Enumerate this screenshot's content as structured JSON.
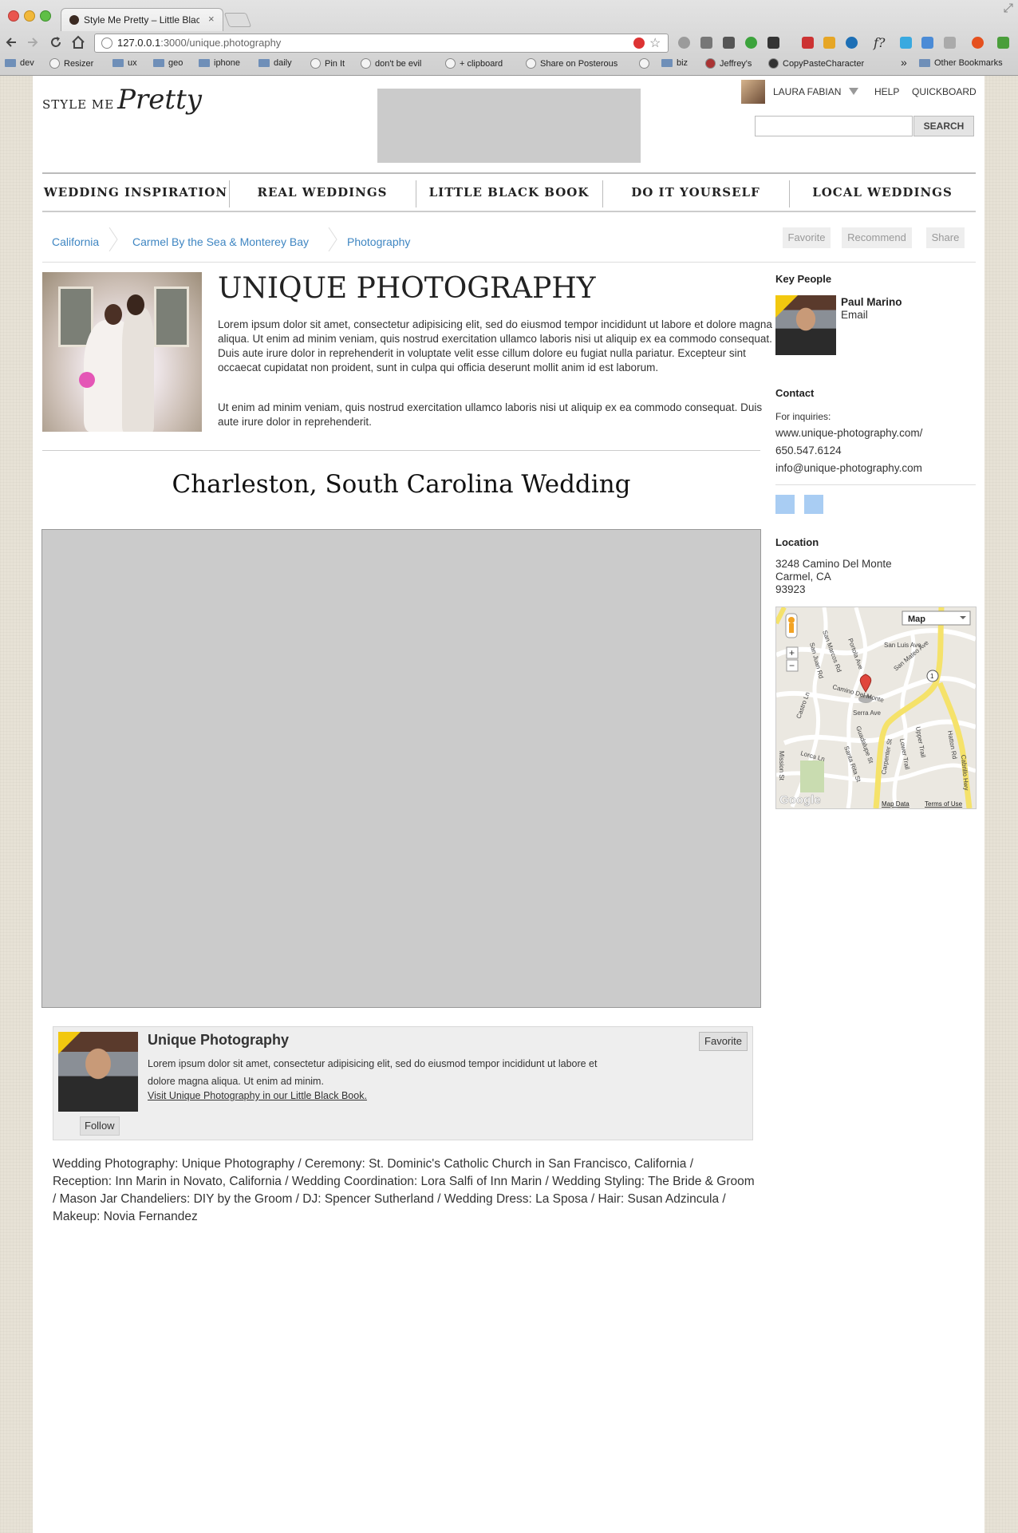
{
  "browser": {
    "tab_title": "Style Me Pretty – Little Black Book",
    "tab_close": "×",
    "url_host": "127.0.0.1",
    "url_rest": ":3000/unique.photography",
    "bookmarks": [
      "dev",
      "Resizer",
      "ux",
      "geo",
      "iphone",
      "daily",
      "Pin It",
      "don't be evil",
      "+ clipboard",
      "Share on Posterous",
      "biz",
      "Jeffrey's",
      "CopyPasteCharacter"
    ],
    "more_bookmarks": "»",
    "other_bookmarks": "Other Bookmarks"
  },
  "header": {
    "logo_style_me": "STYLE ME",
    "logo_pretty": "Pretty",
    "user_name": "LAURA FABIAN",
    "help": "HELP",
    "quickboard": "QUICKBOARD",
    "search_placeholder": "",
    "search_button": "SEARCH"
  },
  "nav": [
    "WEDDING INSPIRATION",
    "REAL WEDDINGS",
    "LITTLE BLACK BOOK",
    "DO IT YOURSELF",
    "LOCAL WEDDINGS"
  ],
  "breadcrumb": [
    "California",
    "Carmel By the Sea & Monterey Bay",
    "Photography"
  ],
  "actions": {
    "favorite": "Favorite",
    "recommend": "Recommend",
    "share": "Share"
  },
  "vendor": {
    "title": "UNIQUE PHOTOGRAPHY",
    "para1": "Lorem ipsum dolor sit amet, consectetur adipisicing elit, sed do eiusmod tempor incididunt ut labore et dolore magna aliqua. Ut enim ad minim veniam, quis nostrud exercitation ullamco laboris nisi ut aliquip ex ea commodo consequat. Duis aute irure dolor in reprehenderit in voluptate velit esse cillum dolore eu fugiat nulla pariatur. Excepteur sint occaecat cupidatat non proident, sunt in culpa qui officia deserunt mollit anim id est laborum.",
    "para2": "Ut enim ad minim veniam, quis nostrud exercitation ullamco laboris nisi ut aliquip ex ea commodo consequat. Duis aute irure dolor in reprehenderit."
  },
  "wedding": {
    "title": "Charleston, South Carolina Wedding"
  },
  "card": {
    "name": "Unique Photography",
    "desc": "Lorem ipsum dolor sit amet, consectetur adipisicing elit, sed do eiusmod tempor incididunt ut labore et dolore magna aliqua. Ut enim ad minim.",
    "link": "Visit Unique Photography in our Little Black Book.",
    "favorite": "Favorite",
    "follow": "Follow"
  },
  "credits": "Wedding Photography: Unique Photography / Ceremony: St. Dominic's Catholic Church in San Francisco, California / Reception: Inn Marin in Novato, California / Wedding Coordination: Lora Salfi of Inn Marin / Wedding Styling: The Bride & Groom / Mason Jar Chandeliers: DIY by the Groom / DJ: Spencer Sutherland / Wedding Dress: La Sposa / Hair: Susan Adzincula / Makeup: Novia Fernandez",
  "sidebar": {
    "key_people_heading": "Key People",
    "person_name": "Paul Marino",
    "person_email": "Email",
    "contact_heading": "Contact",
    "inquiries_label": "For inquiries:",
    "website": "www.unique-photography.com/",
    "phone": "650.547.6124",
    "email": "info@unique-photography.com",
    "location_heading": "Location",
    "address1": "3248 Camino Del Monte",
    "address2": "Carmel, CA",
    "address3": "93923"
  },
  "map": {
    "type_label": "Map",
    "zoom_in": "+",
    "zoom_out": "−",
    "streets": [
      "San Luis Ave",
      "San Marcos Rd",
      "Portola Ave",
      "San Juan Rd",
      "San Mateo Ave",
      "Camino Del Monte",
      "Serra Ave",
      "Castro Ln",
      "Carpenter St",
      "Guadalupe St",
      "Lower Trail",
      "Upper Trail",
      "Santa Rita St",
      "Lorca Ln",
      "Mission St",
      "Hatton Rd",
      "Cabrillo Hwy"
    ],
    "route_marker": "1",
    "logo": "Google",
    "attribution_data": "Map Data",
    "attribution_terms": "Terms of Use"
  },
  "colors": {
    "accent_link": "#3f86c2",
    "badge": "#f2c80f",
    "social": "#a9cdf3"
  }
}
